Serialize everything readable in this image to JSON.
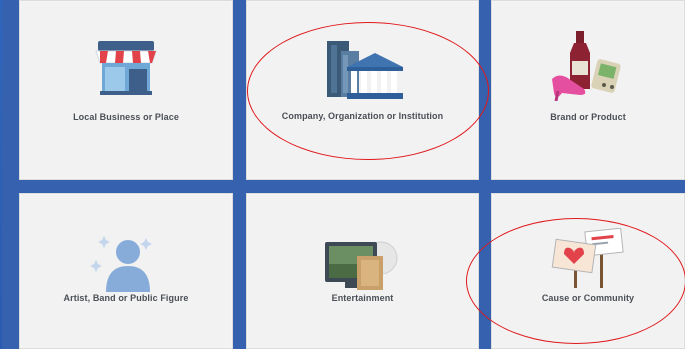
{
  "tiles": [
    {
      "label": "Local Business or Place",
      "icon": "storefront-icon"
    },
    {
      "label": "Company, Organization or Institution",
      "icon": "buildings-icon"
    },
    {
      "label": "Brand or Product",
      "icon": "products-icon"
    },
    {
      "label": "Artist, Band or Public Figure",
      "icon": "person-silhouette-icon"
    },
    {
      "label": "Entertainment",
      "icon": "tv-media-icon"
    },
    {
      "label": "Cause or Community",
      "icon": "protest-signs-icon"
    }
  ],
  "annotations": {
    "circle_color": "#e0181b",
    "circled_tiles": [
      "Company, Organization or Institution",
      "Cause or Community"
    ]
  },
  "colors": {
    "background": "#2d63b8",
    "tile": "#f2f2f2",
    "label_text": "#4b4f56"
  }
}
